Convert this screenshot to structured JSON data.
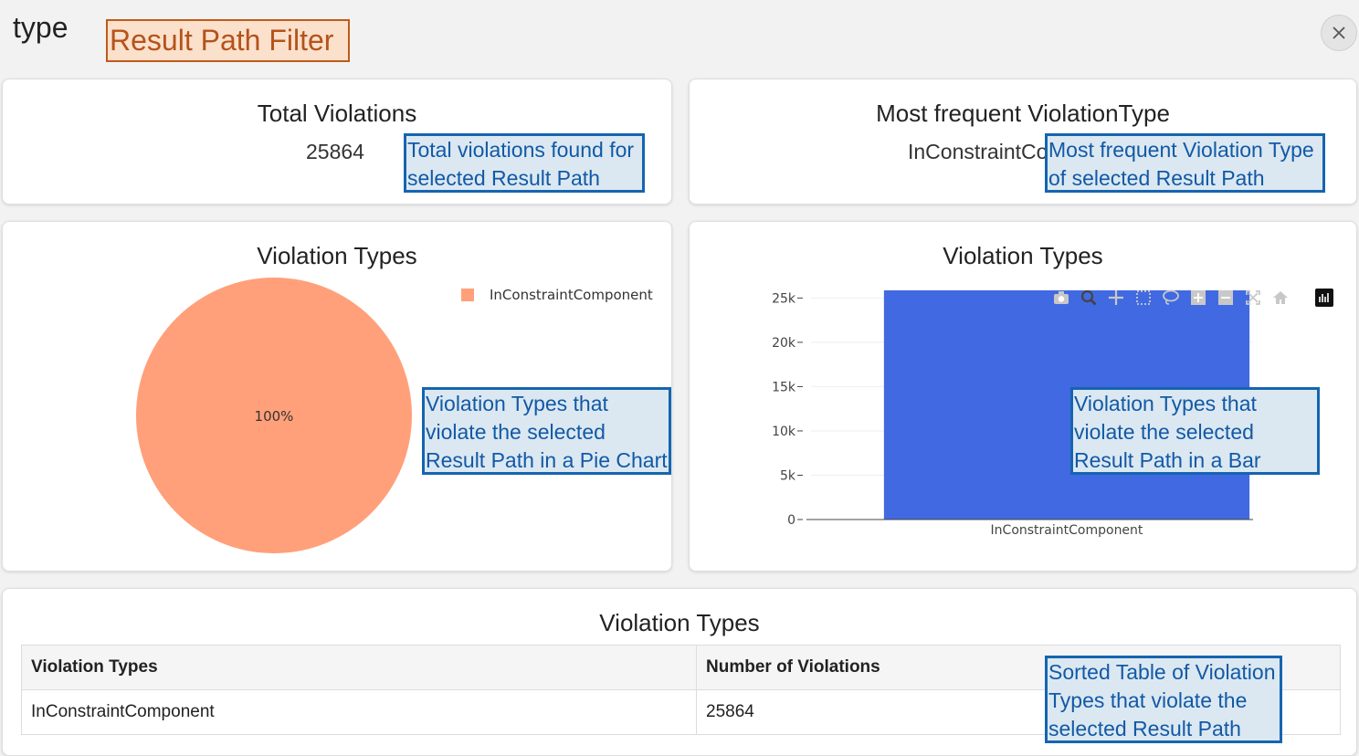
{
  "header": {
    "type_label": "type",
    "filter_annotation": "Result Path Filter",
    "close_icon": "close-icon"
  },
  "total_card": {
    "title": "Total Violations",
    "value": "25864",
    "annotation": "Total violations found  for selected Result Path"
  },
  "frequent_card": {
    "title": "Most frequent ViolationType",
    "value": "InConstraintComponent",
    "annotation": "Most frequent Violation Type of selected Result Path"
  },
  "pie_card": {
    "title": "Violation Types",
    "slice_label": "100%",
    "legend": [
      "InConstraintComponent"
    ],
    "annotation": "Violation Types that violate the selected Result Path in a Pie Chart"
  },
  "bar_card": {
    "title": "Violation Types",
    "annotation": "Violation Types that violate the selected Result Path in a Bar Chart",
    "modebar_icons": [
      "camera-icon",
      "zoom-icon",
      "pan-icon",
      "box-select-icon",
      "lasso-icon",
      "zoom-in-icon",
      "zoom-out-icon",
      "autoscale-icon",
      "reset-axes-icon",
      "plotly-logo-icon"
    ]
  },
  "table_card": {
    "title": "Violation Types",
    "headers": [
      "Violation Types",
      "Number of Violations"
    ],
    "rows": [
      [
        "InConstraintComponent",
        "25864"
      ]
    ],
    "annotation": "Sorted Table of Violation Types that violate the selected Result Path"
  },
  "colors": {
    "pie_slice": "#ffa07a",
    "bar": "#4169e1",
    "annotation_border": "#1565b0",
    "filter_border": "#c05a1a"
  },
  "chart_data": [
    {
      "type": "pie",
      "title": "Violation Types",
      "labels": [
        "InConstraintComponent"
      ],
      "values": [
        100
      ],
      "slice_text": [
        "100%"
      ],
      "legend_position": "top-right"
    },
    {
      "type": "bar",
      "title": "Violation Types",
      "categories": [
        "InConstraintComponent"
      ],
      "values": [
        25864
      ],
      "yticks": [
        "0",
        "5k",
        "10k",
        "15k",
        "20k",
        "25k"
      ],
      "ytick_values": [
        0,
        5000,
        10000,
        15000,
        20000,
        25000
      ],
      "ylim": [
        0,
        25864
      ],
      "xlabel": "",
      "ylabel": "",
      "grid": true
    }
  ]
}
